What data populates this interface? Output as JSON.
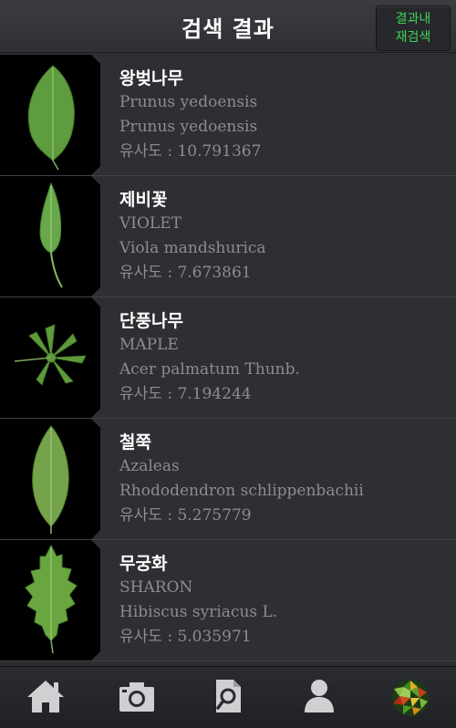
{
  "header": {
    "title": "검색 결과",
    "research_line1": "결과내",
    "research_line2": "재검색"
  },
  "results": [
    {
      "name": "왕벚나무",
      "english": "Prunus yedoensis",
      "scientific": "Prunus yedoensis",
      "similarity": "유사도 : 10.791367"
    },
    {
      "name": "제비꽃",
      "english": "VIOLET",
      "scientific": "Viola mandshurica",
      "similarity": "유사도 : 7.673861"
    },
    {
      "name": "단풍나무",
      "english": "MAPLE",
      "scientific": "Acer palmatum Thunb.",
      "similarity": "유사도 : 7.194244"
    },
    {
      "name": "철쭉",
      "english": "Azaleas",
      "scientific": "Rhododendron schlippenbachii",
      "similarity": "유사도 : 5.275779"
    },
    {
      "name": "무궁화",
      "english": "SHARON",
      "scientific": "Hibiscus syriacus L.",
      "similarity": "유사도 : 5.035971"
    }
  ],
  "tabs": [
    {
      "icon": "home-icon"
    },
    {
      "icon": "camera-icon"
    },
    {
      "icon": "document-search-icon"
    },
    {
      "icon": "user-icon"
    },
    {
      "icon": "leaves-mosaic-icon"
    }
  ],
  "colors": {
    "background": "#2b2d31",
    "accent_green": "#3fd35a",
    "secondary_text": "#8b8d90"
  }
}
